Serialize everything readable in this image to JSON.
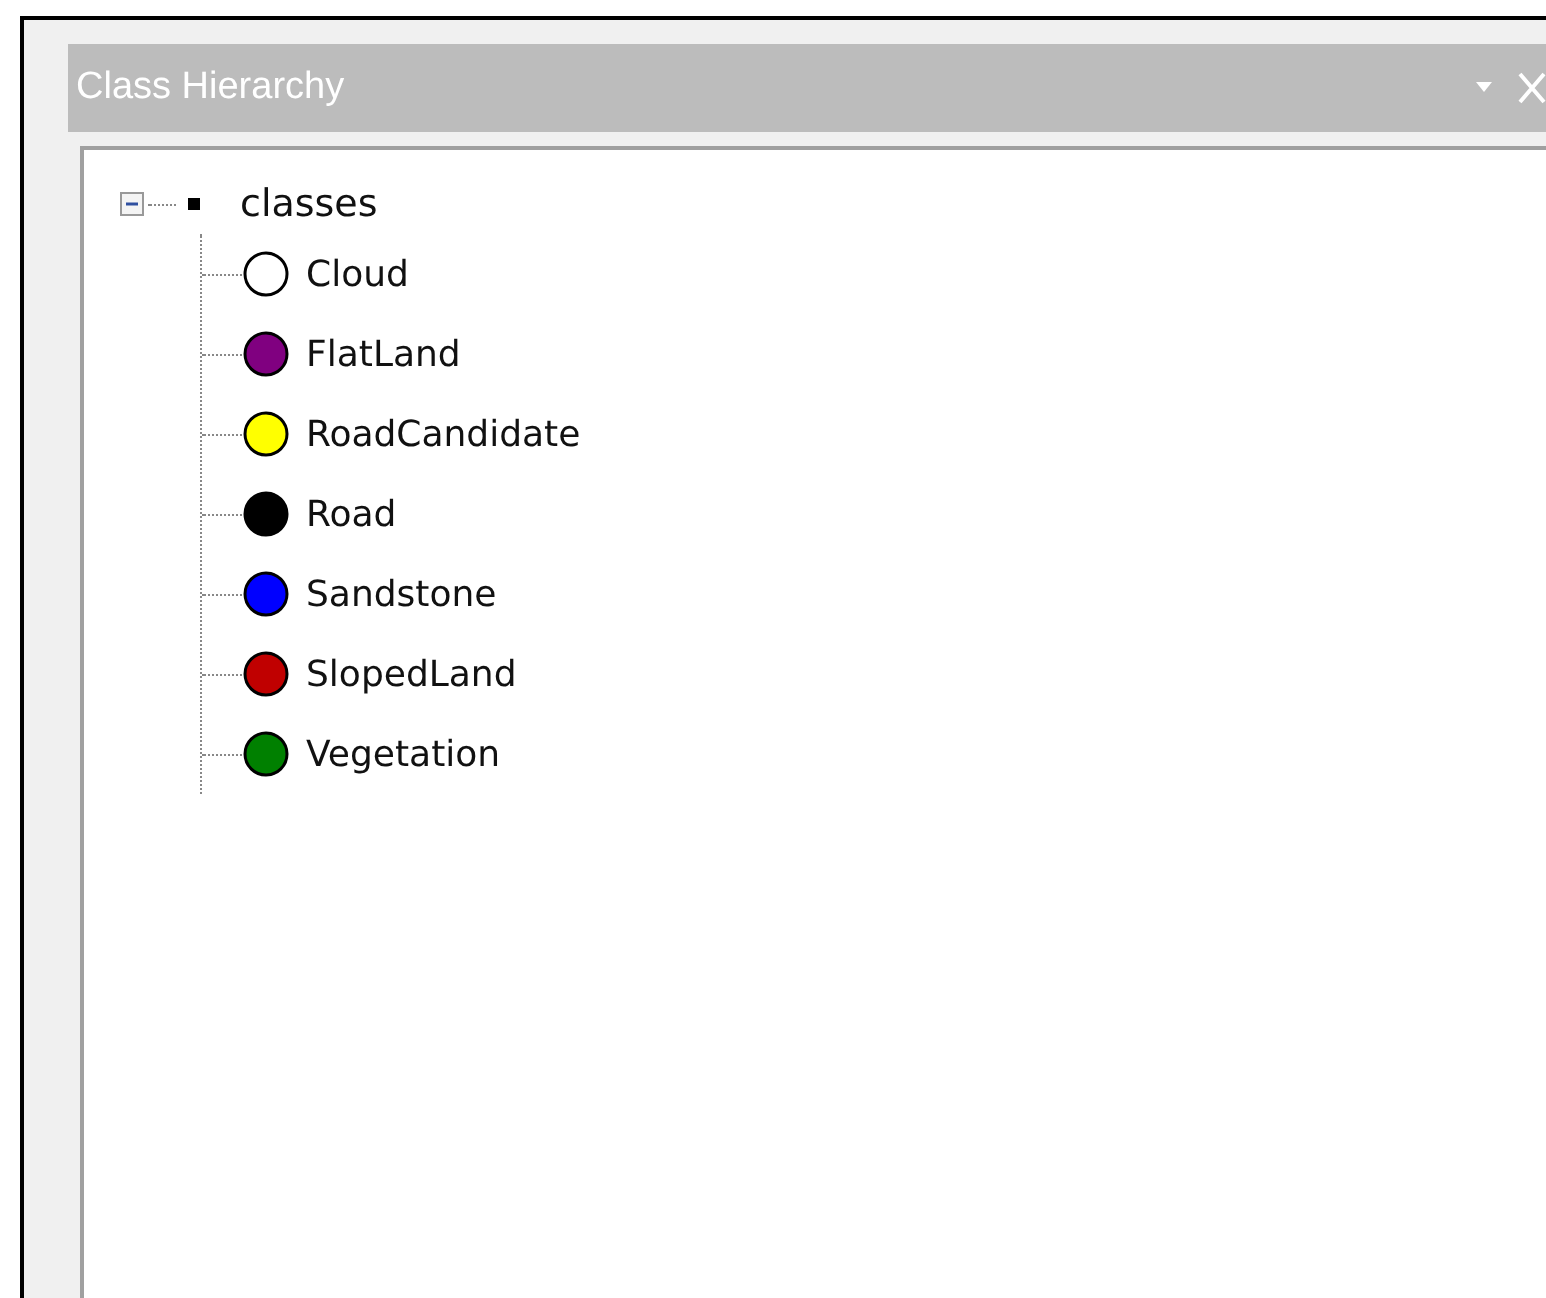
{
  "panel": {
    "title": "Class Hierarchy"
  },
  "tree": {
    "label": "classes",
    "expanded": true,
    "children": [
      {
        "label": "Cloud",
        "color": "#ffffff"
      },
      {
        "label": "FlatLand",
        "color": "#800080"
      },
      {
        "label": "RoadCandidate",
        "color": "#ffff00"
      },
      {
        "label": "Road",
        "color": "#000000"
      },
      {
        "label": "Sandstone",
        "color": "#0000ff"
      },
      {
        "label": "SlopedLand",
        "color": "#c00000"
      },
      {
        "label": "Vegetation",
        "color": "#008000"
      }
    ]
  }
}
